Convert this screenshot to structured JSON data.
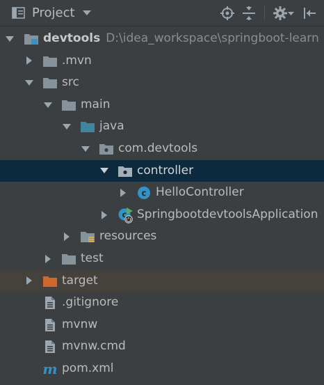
{
  "header": {
    "title": "Project",
    "buttons": [
      "locate-icon",
      "collapse-all-icon",
      "settings-icon",
      "hide-icon"
    ]
  },
  "tree": [
    {
      "name": "devtools",
      "path": "D:\\idea_workspace\\springboot-learn",
      "icon": "module-folder-icon",
      "expanded": true
    },
    {
      "name": ".mvn",
      "icon": "folder-icon",
      "expanded": false
    },
    {
      "name": "src",
      "icon": "folder-icon",
      "expanded": true
    },
    {
      "name": "main",
      "icon": "folder-icon",
      "expanded": true
    },
    {
      "name": "java",
      "icon": "source-folder-icon",
      "expanded": true
    },
    {
      "name": "com.devtools",
      "icon": "package-icon",
      "expanded": true
    },
    {
      "name": "controller",
      "icon": "package-icon",
      "expanded": true,
      "selected": true
    },
    {
      "name": "HelloController",
      "icon": "class-icon",
      "expanded": false
    },
    {
      "name": "SpringbootdevtoolsApplication",
      "icon": "spring-boot-class-icon",
      "expanded": false
    },
    {
      "name": "resources",
      "icon": "resources-folder-icon",
      "expanded": false
    },
    {
      "name": "test",
      "icon": "folder-icon",
      "expanded": false
    },
    {
      "name": "target",
      "icon": "excluded-folder-icon",
      "expanded": false
    },
    {
      "name": ".gitignore",
      "icon": "text-file-icon"
    },
    {
      "name": "mvnw",
      "icon": "text-file-icon"
    },
    {
      "name": "mvnw.cmd",
      "icon": "text-file-icon"
    },
    {
      "name": "pom.xml",
      "icon": "maven-icon"
    }
  ],
  "colors": {
    "background": "#3c3f41",
    "selection": "#0d293e",
    "excluded_row": "#45423d",
    "text": "#bbbbbb",
    "path_text": "#8c8c8c",
    "folder": "#87939a",
    "source_folder": "#3e86a0",
    "excluded_folder": "#d0682e",
    "class_icon": "#3592c4"
  }
}
